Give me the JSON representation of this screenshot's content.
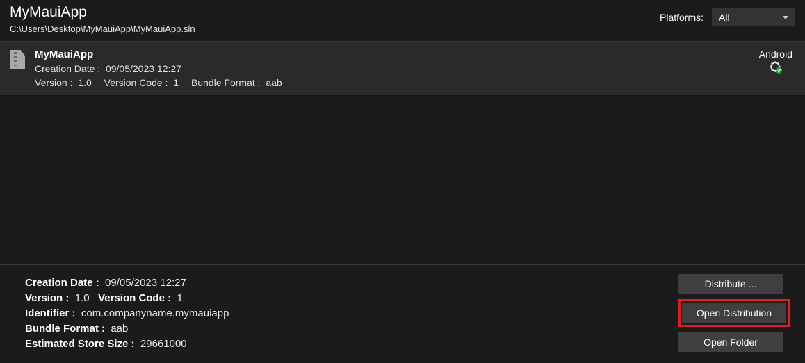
{
  "header": {
    "title": "MyMauiApp",
    "path": "C:\\Users\\Desktop\\MyMauiApp\\MyMauiApp.sln",
    "platforms_label": "Platforms:",
    "platforms_value": "All"
  },
  "archive": {
    "name": "MyMauiApp",
    "creation_date_label": "Creation Date :",
    "creation_date_value": "09/05/2023 12:27",
    "version_label": "Version :",
    "version_value": "1.0",
    "version_code_label": "Version Code :",
    "version_code_value": "1",
    "bundle_format_label": "Bundle Format :",
    "bundle_format_value": "aab",
    "platform": "Android"
  },
  "details": {
    "creation_date_label": "Creation Date :",
    "creation_date_value": "09/05/2023 12:27",
    "version_label": "Version :",
    "version_value": "1.0",
    "version_code_label": "Version Code :",
    "version_code_value": "1",
    "identifier_label": "Identifier :",
    "identifier_value": "com.companyname.mymauiapp",
    "bundle_format_label": "Bundle Format :",
    "bundle_format_value": "aab",
    "est_size_label": "Estimated Store Size :",
    "est_size_value": "29661000"
  },
  "buttons": {
    "distribute": "Distribute ...",
    "open_distribution": "Open Distribution",
    "open_folder": "Open Folder"
  }
}
